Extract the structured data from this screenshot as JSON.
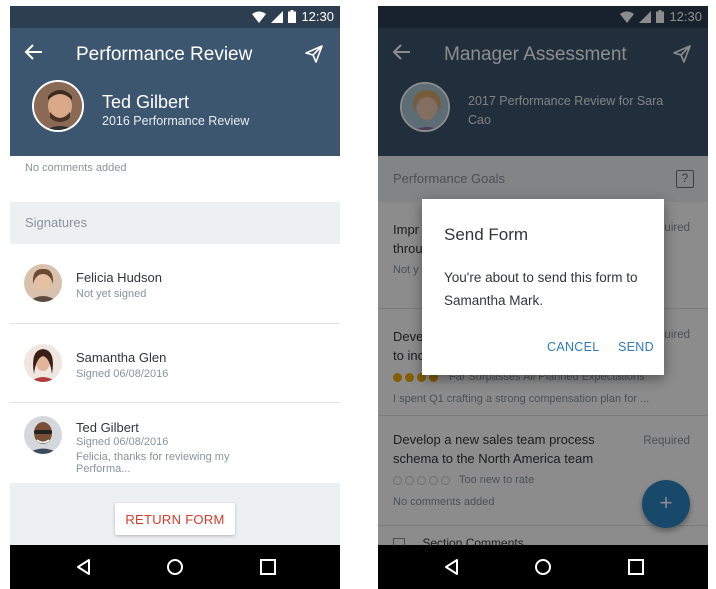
{
  "left": {
    "status_time": "12:30",
    "title": "Performance Review",
    "employee_name": "Ted Gilbert",
    "review_subtitle": "2016 Performance Review",
    "no_comments": "No comments added",
    "signatures_header": "Signatures",
    "signatures": [
      {
        "name": "Felicia Hudson",
        "status": "Not yet signed",
        "comment": ""
      },
      {
        "name": "Samantha Glen",
        "status": "Signed 06/08/2016",
        "comment": ""
      },
      {
        "name": "Ted Gilbert",
        "status": "Signed 06/08/2016",
        "comment": "Felicia, thanks for reviewing my Performa..."
      }
    ],
    "return_button": "RETURN FORM"
  },
  "right": {
    "status_time": "12:30",
    "title": "Manager Assessment",
    "review_subtitle": "2017 Performance Review for Sara Cao",
    "section_header": "Performance Goals",
    "help_icon_label": "?",
    "goals": [
      {
        "title_partial_1": "Impr",
        "title_partial_2": "throu",
        "req_partial": "uired",
        "note_partial": "Not y"
      },
      {
        "title_partial_1": "Deve",
        "title_partial_2": "to inc",
        "req_partial": "uired",
        "rating_text": "Far Surpasses All Planned Expectations",
        "rating": 4,
        "comment": "I spent Q1 crafting a strong compensation plan for ..."
      },
      {
        "title": "Develop a new sales team process schema to the North America team",
        "required": "Required",
        "rating_text": "Too new to rate",
        "rating": 0,
        "comment": "No comments added"
      }
    ],
    "section_comments_partial": "Section Comments",
    "dialog": {
      "title": "Send Form",
      "body": "You're about to send this form to Samantha Mark.",
      "cancel": "CANCEL",
      "send": "SEND"
    },
    "fab_label": "+"
  },
  "colors": {
    "appbar": "#3d5670",
    "statusbar": "#2c3e50",
    "accent_red": "#d63b2a",
    "accent_blue": "#2f7bbd",
    "fab": "#2e86c1",
    "star_filled": "#f0ab00"
  },
  "icons": [
    "back-arrow-icon",
    "send-paper-plane-icon",
    "wifi-icon",
    "signal-icon",
    "battery-icon",
    "nav-back-icon",
    "nav-home-icon",
    "nav-recents-icon",
    "help-icon",
    "add-icon"
  ]
}
